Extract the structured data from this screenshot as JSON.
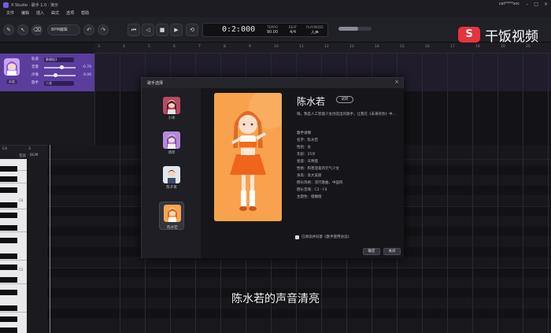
{
  "window": {
    "title": "X Studio · 歌手 1.0 · 演示",
    "user": "cat****soc"
  },
  "menu": [
    "文件",
    "编辑",
    "插入",
    "曲式",
    "选项",
    "帮助"
  ],
  "toolbar": {
    "selector": "BPM编辑",
    "time": "0:2:000",
    "tempo_label": "TEMPO",
    "tempo_value": "90.00",
    "beat_label": "BEAT",
    "beat_value": "4/4",
    "key_label": "PLAYMODE",
    "key_value": "人声"
  },
  "voice_panel": {
    "singer_badge": "水若",
    "rows": [
      {
        "label": "轨道",
        "dropdown": "歌唱轨1"
      },
      {
        "label": "音量",
        "value": "-0.70"
      },
      {
        "label": "声像",
        "value": "0.00"
      },
      {
        "label": "歌手",
        "dropdown": "二花"
      }
    ]
  },
  "ruler_ticks": [
    "3",
    "4",
    "5",
    "6",
    "7",
    "8",
    "9",
    "10",
    "11",
    "12",
    "13",
    "14",
    "15",
    "16",
    "17",
    "18",
    "19",
    "20"
  ],
  "piano_head": {
    "a": "C4",
    "b": "3",
    "c": "0:00",
    "d": "音高",
    "e": "BGM",
    "f": "伴奏"
  },
  "piano_labels": [
    "C4",
    "C3"
  ],
  "watermark": {
    "logo": "S",
    "text": "干饭视频"
  },
  "dialog": {
    "title": "歌手选择",
    "close": "×",
    "voices": [
      {
        "name": "小冰"
      },
      {
        "name": "诗岸"
      },
      {
        "name": "陈子苒"
      },
      {
        "name": "陈水若"
      }
    ],
    "singer_name": "陈水若",
    "demo_label": "试听",
    "description": "嗨，我是人工智能少女创造出的歌手，让我在《未来有你》中...",
    "profile_title": "歌手详情",
    "attributes": [
      "名字：陈水若",
      "性别：女",
      "年龄：25岁",
      "星座：天秤座",
      "性格：和善温柔的元气少女",
      "身高：高大美丽",
      "擅长风格：流行歌曲、中国风",
      "擅长音域：C3 - F4",
      "主题色：橙橘橙"
    ],
    "agree_text": "已阅读并同意《歌手使用协议》",
    "confirm": "确定",
    "cancel": "关闭"
  },
  "subtitle": "陈水若的声音清亮"
}
